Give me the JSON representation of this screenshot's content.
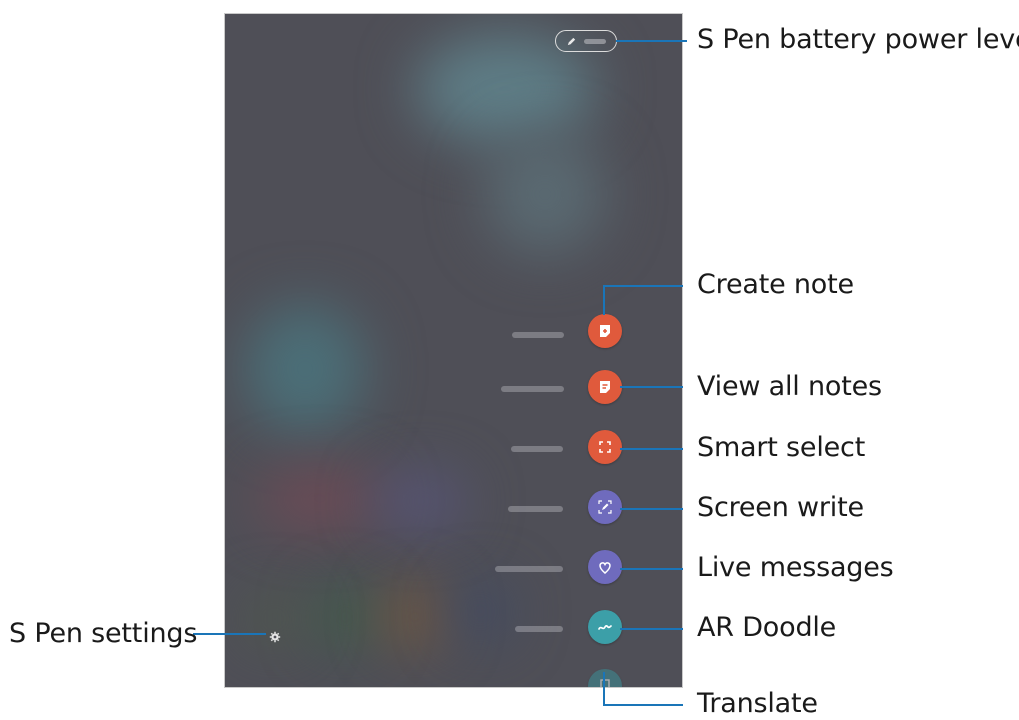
{
  "callouts": {
    "battery": "S Pen battery power level",
    "create_note": "Create note",
    "view_all_notes": "View all notes",
    "smart_select": "Smart select",
    "screen_write": "Screen write",
    "live_messages": "Live messages",
    "ar_doodle": "AR Doodle",
    "translate": "Translate",
    "settings": "S Pen settings"
  },
  "colors": {
    "accent_orange": "#e05a3c",
    "accent_purple": "#6f6bbd",
    "accent_teal": "#3c9fa8",
    "callout_line": "#1a75b8",
    "screen_bg": "#4f4f57"
  },
  "icons": {
    "create_note": "note-add-icon",
    "view_all_notes": "notes-list-icon",
    "smart_select": "smart-select-icon",
    "screen_write": "screen-write-icon",
    "live_messages": "heart-icon",
    "ar_doodle": "doodle-icon",
    "translate": "translate-icon",
    "settings": "gear-icon",
    "battery": "pen-icon"
  }
}
